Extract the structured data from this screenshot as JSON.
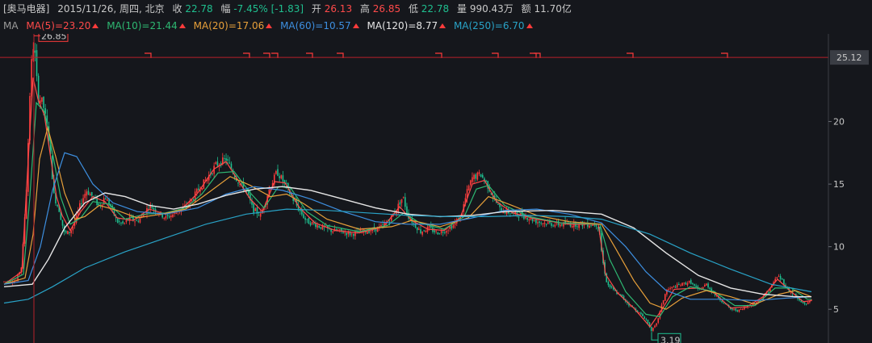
{
  "header": {
    "stock_name": "[奥马电器]",
    "date": "2015/11/26, 周四, 北京",
    "close_label": "收",
    "close_value": "22.78",
    "change_label": "幅",
    "change_pct": "-7.45%",
    "change_abs": "[-1.83]",
    "open_label": "开",
    "open_value": "26.13",
    "high_label": "高",
    "high_value": "26.85",
    "low_label": "低",
    "low_value": "22.78",
    "volume_label": "量",
    "volume_value": "990.43万",
    "amount_label": "额",
    "amount_value": "11.70亿"
  },
  "ma_legend": {
    "prefix": "MA",
    "items": [
      {
        "label": "MA(5)=23.20",
        "color": "#ff4a4a"
      },
      {
        "label": "MA(10)=21.44",
        "color": "#2eb872"
      },
      {
        "label": "MA(20)=17.06",
        "color": "#e8a03a"
      },
      {
        "label": "MA(60)=10.57",
        "color": "#3d8fe0"
      },
      {
        "label": "MA(120)=8.77",
        "color": "#e6e6e6"
      },
      {
        "label": "MA(250)=6.70",
        "color": "#29a3c7"
      }
    ]
  },
  "colors": {
    "up": "#ff3b3b",
    "down": "#1fbf8f",
    "cursor": "#b8202a",
    "crosshair_label_bg": "#3a3d44"
  },
  "chart_data": {
    "type": "candlestick",
    "ylim": [
      2.5,
      27
    ],
    "y_ticks": [
      5,
      10,
      15,
      20
    ],
    "crosshair_price": "25.12",
    "annotations": [
      {
        "text": "26.85",
        "kind": "high",
        "value": 26.85
      },
      {
        "text": "3.19",
        "kind": "low",
        "value": 3.19
      }
    ],
    "x_index_range": [
      0,
      1000
    ],
    "price_path": [
      [
        0,
        7.2
      ],
      [
        15,
        7.3
      ],
      [
        22,
        8.5
      ],
      [
        28,
        15
      ],
      [
        33,
        24
      ],
      [
        37,
        26.5
      ],
      [
        42,
        22
      ],
      [
        48,
        21.5
      ],
      [
        55,
        19
      ],
      [
        62,
        14
      ],
      [
        68,
        13
      ],
      [
        75,
        11
      ],
      [
        82,
        11.2
      ],
      [
        88,
        12
      ],
      [
        95,
        13.5
      ],
      [
        102,
        14.5
      ],
      [
        110,
        14
      ],
      [
        118,
        13.2
      ],
      [
        125,
        14
      ],
      [
        132,
        13.2
      ],
      [
        140,
        12
      ],
      [
        148,
        11.8
      ],
      [
        156,
        12.3
      ],
      [
        164,
        12
      ],
      [
        172,
        12.5
      ],
      [
        180,
        13.3
      ],
      [
        190,
        12.8
      ],
      [
        200,
        12.3
      ],
      [
        210,
        12.6
      ],
      [
        220,
        13
      ],
      [
        230,
        13.5
      ],
      [
        240,
        14.5
      ],
      [
        252,
        15.5
      ],
      [
        262,
        16.5
      ],
      [
        275,
        17
      ],
      [
        285,
        15.8
      ],
      [
        292,
        15
      ],
      [
        300,
        14.5
      ],
      [
        308,
        13
      ],
      [
        318,
        12.5
      ],
      [
        328,
        14.5
      ],
      [
        338,
        16
      ],
      [
        348,
        15
      ],
      [
        356,
        14
      ],
      [
        365,
        13
      ],
      [
        375,
        12
      ],
      [
        385,
        11.8
      ],
      [
        395,
        11.5
      ],
      [
        405,
        11.3
      ],
      [
        418,
        11.2
      ],
      [
        430,
        11
      ],
      [
        442,
        11.2
      ],
      [
        455,
        11.3
      ],
      [
        468,
        11.6
      ],
      [
        478,
        12.2
      ],
      [
        486,
        13
      ],
      [
        494,
        14
      ],
      [
        500,
        12.5
      ],
      [
        508,
        11.8
      ],
      [
        516,
        11.2
      ],
      [
        526,
        11.5
      ],
      [
        536,
        11.1
      ],
      [
        546,
        11.3
      ],
      [
        556,
        11.7
      ],
      [
        566,
        12.5
      ],
      [
        574,
        14.5
      ],
      [
        580,
        15.5
      ],
      [
        590,
        15.8
      ],
      [
        598,
        15
      ],
      [
        606,
        14
      ],
      [
        614,
        13
      ],
      [
        622,
        12.8
      ],
      [
        632,
        12.6
      ],
      [
        642,
        12.5
      ],
      [
        650,
        12.3
      ],
      [
        660,
        12
      ],
      [
        680,
        11.8
      ],
      [
        700,
        11.8
      ],
      [
        734,
        11.8
      ],
      [
        737,
        11.5
      ],
      [
        741,
        9
      ],
      [
        747,
        7
      ],
      [
        755,
        6.5
      ],
      [
        765,
        6
      ],
      [
        775,
        5.3
      ],
      [
        785,
        4.8
      ],
      [
        795,
        4.2
      ],
      [
        802,
        3.3
      ],
      [
        808,
        3.8
      ],
      [
        814,
        5.2
      ],
      [
        820,
        6.5
      ],
      [
        830,
        6.8
      ],
      [
        840,
        7
      ],
      [
        850,
        7.2
      ],
      [
        860,
        6.5
      ],
      [
        870,
        7
      ],
      [
        880,
        6.2
      ],
      [
        890,
        5.6
      ],
      [
        900,
        5
      ],
      [
        910,
        4.9
      ],
      [
        920,
        5.2
      ],
      [
        930,
        5.5
      ],
      [
        940,
        6
      ],
      [
        950,
        6.8
      ],
      [
        958,
        7.7
      ],
      [
        964,
        7.3
      ],
      [
        970,
        6.6
      ],
      [
        978,
        6.2
      ],
      [
        986,
        5.6
      ],
      [
        994,
        5.4
      ],
      [
        1000,
        5.8
      ]
    ],
    "ma_paths": {
      "ma5": [
        [
          0,
          7
        ],
        [
          22,
          8
        ],
        [
          30,
          17
        ],
        [
          36,
          23.5
        ],
        [
          42,
          21.8
        ],
        [
          50,
          20.5
        ],
        [
          58,
          17
        ],
        [
          65,
          14
        ],
        [
          72,
          12.5
        ],
        [
          82,
          11.3
        ],
        [
          95,
          12.8
        ],
        [
          110,
          14
        ],
        [
          125,
          13.6
        ],
        [
          140,
          12.3
        ],
        [
          160,
          12.1
        ],
        [
          180,
          13
        ],
        [
          200,
          12.6
        ],
        [
          220,
          13
        ],
        [
          240,
          14.3
        ],
        [
          260,
          16.2
        ],
        [
          275,
          16.8
        ],
        [
          290,
          15.3
        ],
        [
          305,
          13.8
        ],
        [
          320,
          12.8
        ],
        [
          335,
          15.2
        ],
        [
          348,
          15.1
        ],
        [
          365,
          13.2
        ],
        [
          385,
          11.9
        ],
        [
          410,
          11.3
        ],
        [
          440,
          11.1
        ],
        [
          470,
          11.6
        ],
        [
          490,
          13.2
        ],
        [
          505,
          12.1
        ],
        [
          525,
          11.4
        ],
        [
          545,
          11.3
        ],
        [
          565,
          12.3
        ],
        [
          580,
          15
        ],
        [
          595,
          15.3
        ],
        [
          610,
          13.6
        ],
        [
          630,
          12.7
        ],
        [
          660,
          12.2
        ],
        [
          700,
          11.8
        ],
        [
          736,
          11.8
        ],
        [
          745,
          7.8
        ],
        [
          760,
          6.3
        ],
        [
          780,
          5.1
        ],
        [
          800,
          3.6
        ],
        [
          815,
          5
        ],
        [
          830,
          6.6
        ],
        [
          860,
          6.7
        ],
        [
          880,
          6.3
        ],
        [
          900,
          5.1
        ],
        [
          920,
          5.2
        ],
        [
          940,
          6
        ],
        [
          958,
          7.4
        ],
        [
          975,
          6.4
        ],
        [
          990,
          5.6
        ],
        [
          1000,
          5.7
        ]
      ],
      "ma10": [
        [
          0,
          7
        ],
        [
          24,
          7.8
        ],
        [
          32,
          14
        ],
        [
          40,
          21.5
        ],
        [
          50,
          20.8
        ],
        [
          60,
          17.5
        ],
        [
          70,
          14
        ],
        [
          82,
          11.8
        ],
        [
          95,
          12.3
        ],
        [
          110,
          13.6
        ],
        [
          130,
          13.4
        ],
        [
          150,
          12.2
        ],
        [
          175,
          12.6
        ],
        [
          200,
          12.7
        ],
        [
          225,
          13.1
        ],
        [
          245,
          14.2
        ],
        [
          265,
          15.9
        ],
        [
          285,
          16
        ],
        [
          305,
          14.3
        ],
        [
          322,
          13.1
        ],
        [
          340,
          14.8
        ],
        [
          355,
          14.7
        ],
        [
          375,
          12.8
        ],
        [
          400,
          11.7
        ],
        [
          440,
          11.2
        ],
        [
          475,
          11.7
        ],
        [
          495,
          12.7
        ],
        [
          515,
          11.9
        ],
        [
          545,
          11.4
        ],
        [
          570,
          12.4
        ],
        [
          585,
          14.6
        ],
        [
          600,
          14.9
        ],
        [
          620,
          13.3
        ],
        [
          650,
          12.4
        ],
        [
          690,
          11.9
        ],
        [
          738,
          11.8
        ],
        [
          750,
          9
        ],
        [
          770,
          6.4
        ],
        [
          795,
          4.6
        ],
        [
          812,
          4.4
        ],
        [
          828,
          6
        ],
        [
          850,
          6.8
        ],
        [
          880,
          6.4
        ],
        [
          905,
          5.3
        ],
        [
          930,
          5.3
        ],
        [
          955,
          6.7
        ],
        [
          975,
          6.7
        ],
        [
          995,
          5.8
        ],
        [
          1000,
          5.8
        ]
      ],
      "ma20": [
        [
          0,
          7
        ],
        [
          26,
          7.5
        ],
        [
          36,
          11
        ],
        [
          44,
          17
        ],
        [
          54,
          19.5
        ],
        [
          64,
          17.2
        ],
        [
          75,
          14.3
        ],
        [
          88,
          12.2
        ],
        [
          100,
          12.4
        ],
        [
          118,
          13.3
        ],
        [
          140,
          12.9
        ],
        [
          165,
          12.3
        ],
        [
          195,
          12.6
        ],
        [
          225,
          13
        ],
        [
          255,
          14.4
        ],
        [
          280,
          15.6
        ],
        [
          305,
          14.9
        ],
        [
          330,
          14
        ],
        [
          350,
          14.2
        ],
        [
          372,
          13.4
        ],
        [
          400,
          12.2
        ],
        [
          440,
          11.4
        ],
        [
          480,
          11.6
        ],
        [
          505,
          12.1
        ],
        [
          540,
          11.6
        ],
        [
          575,
          12.3
        ],
        [
          600,
          14
        ],
        [
          625,
          13.4
        ],
        [
          660,
          12.5
        ],
        [
          700,
          12
        ],
        [
          740,
          11.8
        ],
        [
          758,
          9.8
        ],
        [
          780,
          7.3
        ],
        [
          800,
          5.5
        ],
        [
          820,
          5
        ],
        [
          840,
          5.9
        ],
        [
          870,
          6.5
        ],
        [
          900,
          6
        ],
        [
          930,
          5.4
        ],
        [
          960,
          6.2
        ],
        [
          980,
          6.5
        ],
        [
          1000,
          6
        ]
      ],
      "ma60": [
        [
          0,
          7
        ],
        [
          30,
          7.3
        ],
        [
          45,
          10
        ],
        [
          60,
          14.5
        ],
        [
          75,
          17.5
        ],
        [
          90,
          17.2
        ],
        [
          110,
          15
        ],
        [
          135,
          13.5
        ],
        [
          165,
          12.8
        ],
        [
          200,
          12.6
        ],
        [
          240,
          13.1
        ],
        [
          275,
          14.2
        ],
        [
          310,
          14.8
        ],
        [
          345,
          14.5
        ],
        [
          380,
          13.8
        ],
        [
          420,
          12.8
        ],
        [
          460,
          12
        ],
        [
          500,
          11.8
        ],
        [
          540,
          11.8
        ],
        [
          580,
          12.3
        ],
        [
          620,
          12.9
        ],
        [
          660,
          13
        ],
        [
          700,
          12.6
        ],
        [
          740,
          11.9
        ],
        [
          770,
          10
        ],
        [
          795,
          8
        ],
        [
          820,
          6.5
        ],
        [
          850,
          5.8
        ],
        [
          890,
          5.8
        ],
        [
          930,
          5.7
        ],
        [
          970,
          5.9
        ],
        [
          1000,
          6
        ]
      ],
      "ma120": [
        [
          0,
          6.8
        ],
        [
          35,
          7
        ],
        [
          55,
          9
        ],
        [
          75,
          11.5
        ],
        [
          100,
          13.5
        ],
        [
          125,
          14.3
        ],
        [
          150,
          14
        ],
        [
          180,
          13.3
        ],
        [
          210,
          13
        ],
        [
          240,
          13.4
        ],
        [
          275,
          14.1
        ],
        [
          310,
          14.6
        ],
        [
          345,
          14.8
        ],
        [
          380,
          14.5
        ],
        [
          420,
          13.8
        ],
        [
          460,
          13.1
        ],
        [
          500,
          12.6
        ],
        [
          540,
          12.4
        ],
        [
          580,
          12.5
        ],
        [
          620,
          12.8
        ],
        [
          680,
          12.9
        ],
        [
          740,
          12.6
        ],
        [
          780,
          11.5
        ],
        [
          820,
          9.5
        ],
        [
          860,
          7.7
        ],
        [
          900,
          6.7
        ],
        [
          940,
          6.2
        ],
        [
          980,
          6
        ],
        [
          1000,
          6
        ]
      ],
      "ma250": [
        [
          0,
          5.5
        ],
        [
          30,
          5.8
        ],
        [
          60,
          6.8
        ],
        [
          100,
          8.3
        ],
        [
          150,
          9.6
        ],
        [
          200,
          10.7
        ],
        [
          250,
          11.8
        ],
        [
          300,
          12.6
        ],
        [
          350,
          13
        ],
        [
          400,
          12.9
        ],
        [
          450,
          12.7
        ],
        [
          500,
          12.5
        ],
        [
          550,
          12.4
        ],
        [
          600,
          12.4
        ],
        [
          650,
          12.5
        ],
        [
          700,
          12.4
        ],
        [
          740,
          12.2
        ],
        [
          800,
          11
        ],
        [
          850,
          9.5
        ],
        [
          900,
          8.2
        ],
        [
          950,
          7
        ],
        [
          1000,
          6.4
        ]
      ]
    },
    "markers": [
      178,
      300,
      325,
      335,
      378,
      416,
      538,
      608,
      655,
      660,
      775,
      892
    ]
  }
}
